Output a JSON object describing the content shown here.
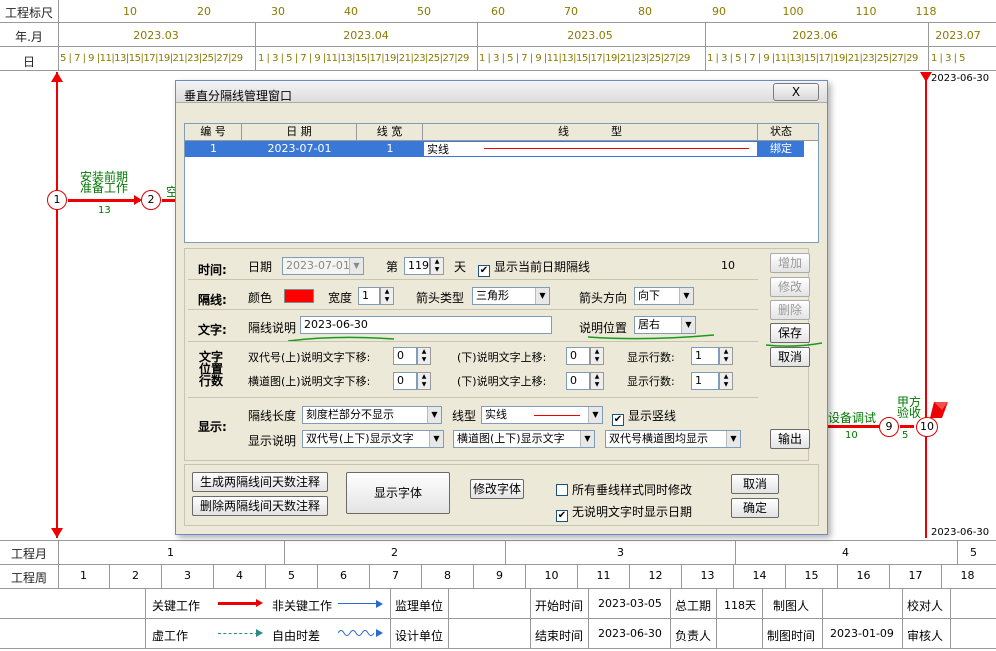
{
  "header": {
    "scale_label": "工程标尺",
    "month_label": "年.月",
    "day_label": "日",
    "scale_ticks": [
      "10",
      "20",
      "30",
      "40",
      "50",
      "60",
      "70",
      "80",
      "90",
      "100",
      "110",
      "118"
    ],
    "months": [
      "2023.03",
      "2023.04",
      "2023.05",
      "2023.06",
      "2023.07"
    ],
    "days_mar": "5 | 7 | 9 |11|13|15|17|19|21|23|25|27|29",
    "days_apr": "1 | 3 | 5 | 7 | 9 |11|13|15|17|19|21|23|25|27|29",
    "days_may": "1 | 3 | 5 | 7 | 9 |11|13|15|17|19|21|23|25|27|29",
    "days_jun": "1 | 3 | 5 | 7 | 9 |11|13|15|17|19|21|23|25|27|29",
    "days_jul": "1 | 3 | 5"
  },
  "diagram": {
    "date_top": "2023-06-30",
    "date_bottom": "2023-06-30",
    "task1_line1": "安装前期",
    "task1_line2": "准备工作",
    "task1_days": "13",
    "task2_partial": "空",
    "node1": "1",
    "node2": "2",
    "node9": "9",
    "node10": "10",
    "task_right_label": "设备调试",
    "task_right_days": "10",
    "task_final_line1": "甲方",
    "task_final_line2": "验收",
    "task_final_days": "5"
  },
  "footer": {
    "project_month_label": "工程月",
    "project_week_label": "工程周",
    "project_months": [
      "1",
      "2",
      "3",
      "4",
      "5"
    ],
    "project_weeks": [
      "1",
      "2",
      "3",
      "4",
      "5",
      "6",
      "7",
      "8",
      "9",
      "10",
      "11",
      "12",
      "13",
      "14",
      "15",
      "16",
      "17",
      "18"
    ],
    "legend_critical": "关键工作",
    "legend_noncritical": "非关键工作",
    "legend_virtual": "虚工作",
    "legend_free": "自由时差",
    "supervisor": "监理单位",
    "designer": "设计单位",
    "start_label": "开始时间",
    "start_value": "2023-03-05",
    "end_label": "结束时间",
    "end_value": "2023-06-30",
    "duration_label": "总工期",
    "duration_value": "118天",
    "owner_label": "负责人",
    "drawer_label": "制图人",
    "draw_time_label": "制图时间",
    "draw_time_value": "2023-01-09",
    "checker_label": "校对人",
    "reviewer_label": "审核人"
  },
  "dialog": {
    "title": "垂直分隔线管理窗口",
    "close": "X",
    "table_headers": [
      "编 号",
      "日 期",
      "线 宽",
      "线            型",
      "状态"
    ],
    "row": {
      "id": "1",
      "date": "2023-07-01",
      "width": "1",
      "type": "实线",
      "status": "绑定"
    },
    "time_label": "时间:",
    "date_label": "日期",
    "date_value": "2023-07-01",
    "day_prefix": "第",
    "day_value": "119",
    "day_suffix": "天",
    "show_current_date": "显示当前日期隔线",
    "count_value": "10",
    "line_label": "隔线:",
    "color_label": "颜色",
    "color_value": "#ff0000",
    "width_label": "宽度",
    "width_value": "1",
    "arrow_type_label": "箭头类型",
    "arrow_type_value": "三角形",
    "arrow_dir_label": "箭头方向",
    "arrow_dir_value": "向下",
    "text_label": "文字:",
    "desc_label": "隔线说明",
    "desc_value": "2023-06-30",
    "desc_pos_label": "说明位置",
    "desc_pos_value": "居右",
    "offset_label": "文字位置行数",
    "dbl_up": "双代号(上)说明文字下移:",
    "dbl_up_v": "0",
    "dbl_down": "(下)说明文字上移:",
    "dbl_down_v": "0",
    "dbl_rows": "显示行数:",
    "dbl_rows_v": "1",
    "hor_up": "横道图(上)说明文字下移:",
    "hor_up_v": "0",
    "hor_down": "(下)说明文字上移:",
    "hor_down_v": "0",
    "hor_rows": "显示行数:",
    "hor_rows_v": "1",
    "display_label": "显示:",
    "len_label": "隔线长度",
    "len_value": "刻度栏部分不显示",
    "ltype_label": "线型",
    "ltype_value": "实线",
    "show_vline": "显示竖线",
    "show_desc_label": "显示说明",
    "show_desc_v1": "双代号(上下)显示文字",
    "show_desc_v2": "横道图(上下)显示文字",
    "show_desc_v3": "双代号横道图均显示",
    "btn_add": "增加",
    "btn_edit": "修改",
    "btn_delete": "删除",
    "btn_save": "保存",
    "btn_cancel1": "取消",
    "btn_output": "输出",
    "btn_gen_note": "生成两隔线间天数注释",
    "btn_del_note": "删除两隔线间天数注释",
    "btn_show_font": "显示字体",
    "btn_edit_font": "修改字体",
    "chk_all": "所有垂线样式同时修改",
    "chk_nodesc": "无说明文字时显示日期",
    "btn_cancel2": "取消",
    "btn_ok": "确定"
  }
}
